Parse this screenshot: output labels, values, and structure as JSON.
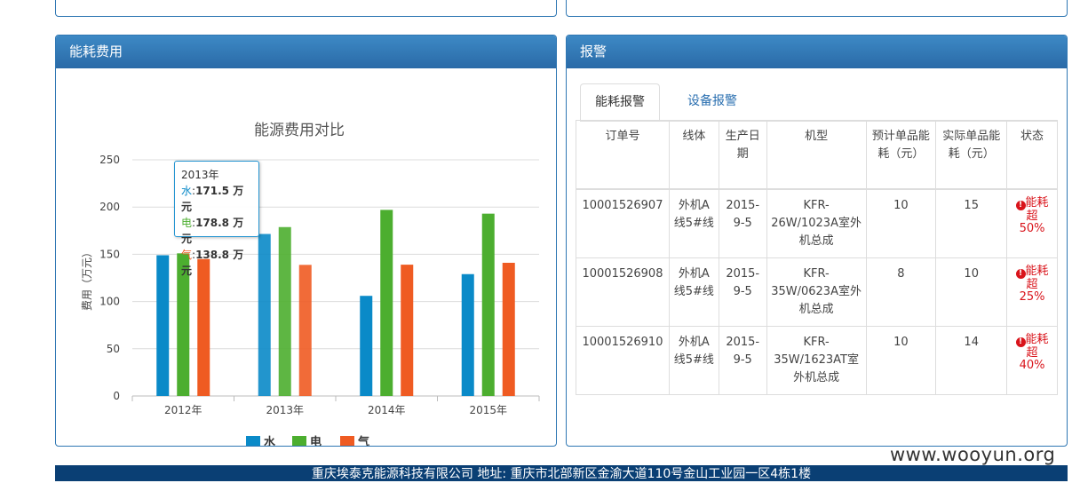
{
  "energy_panel": {
    "title": "能耗费用"
  },
  "alarm_panel": {
    "title": "报警",
    "tabs": [
      {
        "label": "能耗报警",
        "active": true
      },
      {
        "label": "设备报警",
        "active": false
      }
    ],
    "columns": [
      "订单号",
      "线体",
      "生产日期",
      "机型",
      "预计单品能耗（元）",
      "实际单品能耗（元）",
      "状态"
    ],
    "rows": [
      {
        "order": "10001526907",
        "line": "外机A线5#线",
        "date": "2015-9-5",
        "model": "KFR-26W/1023A室外机总成",
        "expected": "10",
        "actual": "15",
        "status": "能耗超",
        "pct": "50%"
      },
      {
        "order": "10001526908",
        "line": "外机A线5#线",
        "date": "2015-9-5",
        "model": "KFR-35W/0623A室外机总成",
        "expected": "8",
        "actual": "10",
        "status": "能耗超",
        "pct": "25%"
      },
      {
        "order": "10001526910",
        "line": "外机A线5#线",
        "date": "2015-9-5",
        "model": "KFR-35W/1623AT室外机总成",
        "expected": "10",
        "actual": "14",
        "status": "能耗超",
        "pct": "40%"
      }
    ]
  },
  "colors": {
    "water": "#0a8ac8",
    "electric": "#4cae2f",
    "gas": "#ef5b22",
    "header": "#2f77b3",
    "footer": "#0a3f74"
  },
  "chart_data": {
    "type": "bar",
    "title": "能源费用对比",
    "ylabel": "费用（万元）",
    "categories": [
      "2012年",
      "2013年",
      "2014年",
      "2015年"
    ],
    "ylim": [
      0,
      250
    ],
    "yticks": [
      0,
      50,
      100,
      150,
      200,
      250
    ],
    "series": [
      {
        "name": "水",
        "values": [
          149,
          171.5,
          106,
          129
        ]
      },
      {
        "name": "电",
        "values": [
          151,
          178.8,
          197,
          193
        ]
      },
      {
        "name": "气",
        "values": [
          145,
          138.8,
          139,
          141
        ]
      }
    ],
    "legend": "bottom",
    "grid": true,
    "tooltip": {
      "category": "2013年",
      "rows": [
        {
          "series": "水",
          "value": "171.5 万元"
        },
        {
          "series": "电",
          "value": "178.8 万元"
        },
        {
          "series": "气",
          "value": "138.8 万元"
        }
      ]
    }
  },
  "footer": {
    "text": "重庆埃泰克能源科技有限公司 地址: 重庆市北部新区金渝大道110号金山工业园一区4栋1楼"
  },
  "watermark": "www.wooyun.org"
}
